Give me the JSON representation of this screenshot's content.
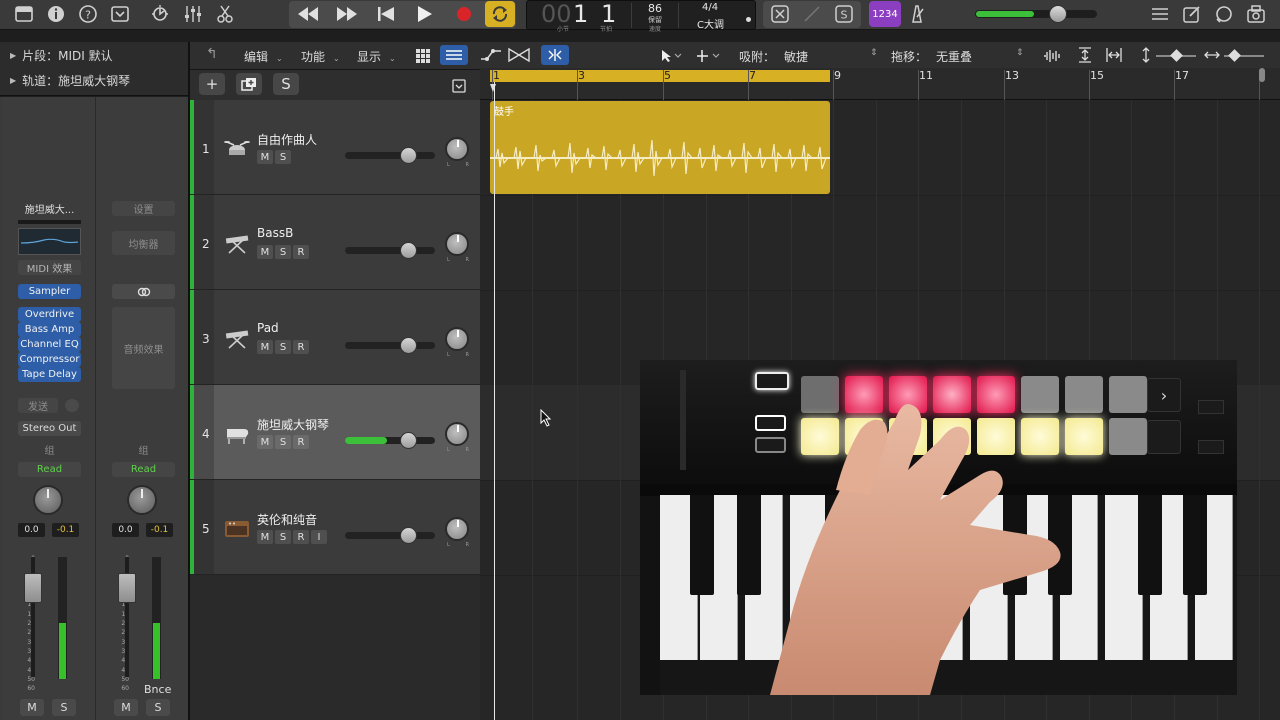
{
  "transport": {
    "bar": "1",
    "beat": "1",
    "bar_label": "小节",
    "beat_label": "节拍",
    "tempo": "86",
    "tempo_mode": "保留",
    "tempo_label": "速度",
    "signature": "4/4",
    "key": "C大调",
    "count_in": "1234"
  },
  "inspector": {
    "region_row": "片段：MIDI 默认",
    "track_row": "轨道：施坦威大钢琴",
    "strip1": {
      "name": "施坦威大...",
      "midi_fx": "MIDI 效果",
      "instrument": "Sampler",
      "fx": [
        "Overdrive",
        "Bass Amp",
        "Channel EQ",
        "Compressor",
        "Tape Delay"
      ],
      "send": "发送",
      "output": "Stereo Out",
      "group": "组",
      "automation": "Read",
      "vol": "0.0",
      "peak": "-0.1",
      "mute": "M",
      "solo": "S"
    },
    "strip2": {
      "setting": "设置",
      "eq": "均衡器",
      "audio_fx": "音频效果",
      "group": "组",
      "automation": "Read",
      "vol": "0.0",
      "peak": "-0.1",
      "name": "Bnce",
      "mute": "M",
      "solo": "S"
    },
    "scale": [
      "0",
      "3",
      "6",
      "9",
      "12",
      "15",
      "18",
      "21",
      "24",
      "30",
      "35",
      "40",
      "45",
      "50",
      "60"
    ]
  },
  "toolbar": {
    "edit": "编辑",
    "functions": "功能",
    "view": "显示",
    "snap_label": "吸附：",
    "snap_value": "敏捷",
    "drag_label": "拖移：",
    "drag_value": "无重叠"
  },
  "track_header": {
    "add": "+",
    "solo": "S"
  },
  "ruler": [
    "1",
    "3",
    "5",
    "7",
    "9",
    "11",
    "13",
    "15",
    "17"
  ],
  "tracks": [
    {
      "num": "1",
      "name": "自由作曲人",
      "buttons": [
        "M",
        "S"
      ],
      "volume_pct": 72
    },
    {
      "num": "2",
      "name": "BassB",
      "buttons": [
        "M",
        "S",
        "R"
      ],
      "volume_pct": 72
    },
    {
      "num": "3",
      "name": "Pad",
      "buttons": [
        "M",
        "S",
        "R"
      ],
      "volume_pct": 72
    },
    {
      "num": "4",
      "name": "施坦威大钢琴",
      "buttons": [
        "M",
        "S",
        "R"
      ],
      "volume_pct": 72
    },
    {
      "num": "5",
      "name": "英伦和纯音",
      "buttons": [
        "M",
        "S",
        "R",
        "I"
      ],
      "volume_pct": 72
    }
  ],
  "pan_lr": [
    "L",
    "R"
  ],
  "region": {
    "name": "鼓手"
  },
  "colors": {
    "accent_yellow": "#d8b024",
    "region_yellow": "#c9a624",
    "track_green": "#2fb43a",
    "selected_blue": "#2d5ea7",
    "record_red": "#d9252a"
  }
}
